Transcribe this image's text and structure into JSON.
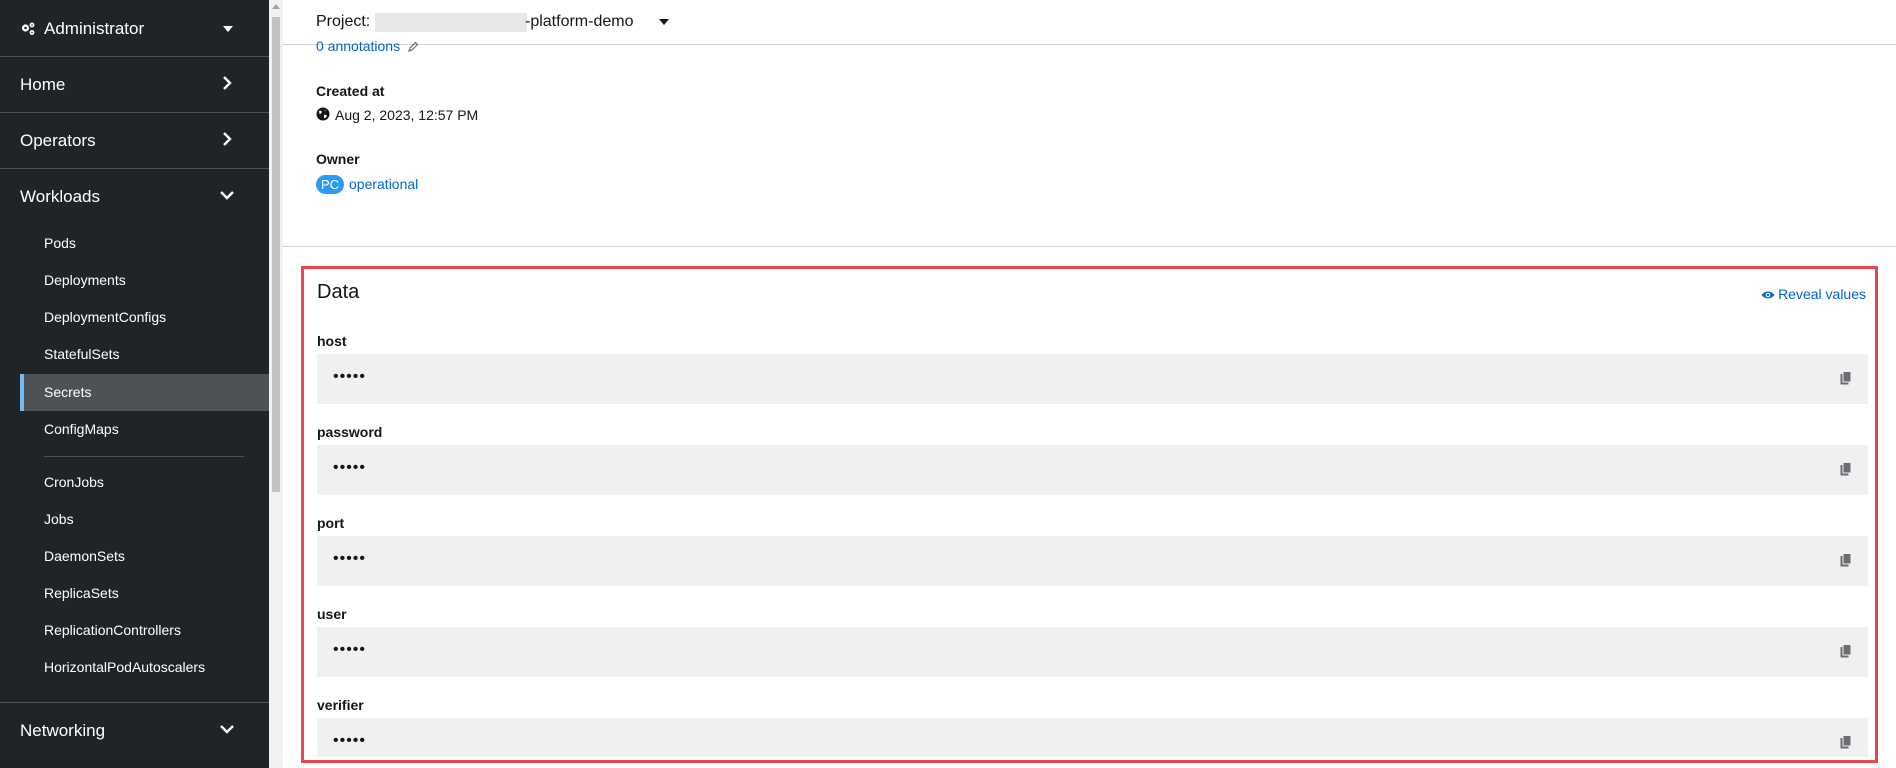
{
  "sidebar": {
    "perspective": "Administrator",
    "sections": {
      "home": "Home",
      "operators": "Operators",
      "workloads": "Workloads",
      "networking": "Networking"
    },
    "workload_items": [
      "Pods",
      "Deployments",
      "DeploymentConfigs",
      "StatefulSets",
      "Secrets",
      "ConfigMaps",
      "CronJobs",
      "Jobs",
      "DaemonSets",
      "ReplicaSets",
      "ReplicationControllers",
      "HorizontalPodAutoscalers"
    ],
    "active_item": "Secrets"
  },
  "header": {
    "project_label": "Project:",
    "project_name": "-platform-demo"
  },
  "details": {
    "annotations_link": "0 annotations",
    "created_at_label": "Created at",
    "created_at_value": "Aug 2, 2023, 12:57 PM",
    "owner_label": "Owner",
    "owner_badge": "PC",
    "owner_name": "operational"
  },
  "data_section": {
    "title": "Data",
    "reveal_label": "Reveal values",
    "fields": [
      {
        "key": "host",
        "value": "•••••"
      },
      {
        "key": "password",
        "value": "•••••"
      },
      {
        "key": "port",
        "value": "•••••"
      },
      {
        "key": "user",
        "value": "•••••"
      },
      {
        "key": "verifier",
        "value": "•••••"
      }
    ]
  },
  "colors": {
    "sidebar_bg": "#212427",
    "active_item_bg": "#4f5255",
    "active_bar": "#73bcf7",
    "link": "#0066cc",
    "highlight_border": "#e5484d",
    "badge": "#2b9af3"
  }
}
